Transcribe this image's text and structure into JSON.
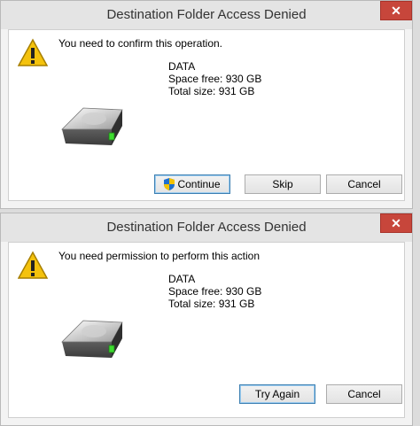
{
  "dialog1": {
    "title": "Destination Folder Access Denied",
    "close_label": "✕",
    "message": "You need to confirm this operation.",
    "drive_name": "DATA",
    "space_free": "Space free: 930 GB",
    "total_size": "Total size: 931 GB",
    "buttons": {
      "continue": "Continue",
      "skip": "Skip",
      "cancel": "Cancel"
    }
  },
  "dialog2": {
    "title": "Destination Folder Access Denied",
    "close_label": "✕",
    "message": "You need permission to perform this action",
    "drive_name": "DATA",
    "space_free": "Space free: 930 GB",
    "total_size": "Total size: 931 GB",
    "buttons": {
      "try_again": "Try Again",
      "cancel": "Cancel"
    }
  },
  "colors": {
    "close_button": "#c7463b",
    "warning_yellow": "#f4c20d",
    "focus_border": "#3c7fb1"
  },
  "icons": [
    "warning-icon",
    "drive-icon",
    "uac-shield-icon",
    "close-icon"
  ]
}
